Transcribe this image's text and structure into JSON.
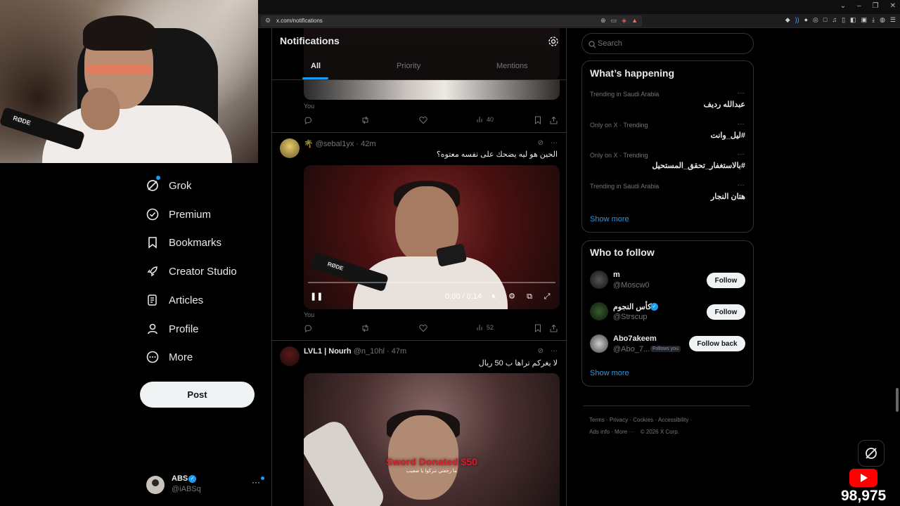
{
  "browser": {
    "url": "x.com/notifications",
    "window_controls": [
      "⌄",
      "–",
      "❐",
      "✕"
    ]
  },
  "nav": {
    "items": [
      {
        "label": "Grok",
        "icon": "grok-icon"
      },
      {
        "label": "Premium",
        "icon": "premium-icon"
      },
      {
        "label": "Bookmarks",
        "icon": "bookmark-icon"
      },
      {
        "label": "Creator Studio",
        "icon": "rocket-icon"
      },
      {
        "label": "Articles",
        "icon": "articles-icon"
      },
      {
        "label": "Profile",
        "icon": "profile-icon"
      },
      {
        "label": "More",
        "icon": "more-icon"
      }
    ],
    "post_label": "Post",
    "account": {
      "name": "ABS",
      "handle": "@iABSq",
      "more": "···"
    }
  },
  "notifications": {
    "title": "Notifications",
    "tabs": [
      "All",
      "Priority",
      "Mentions"
    ],
    "active_tab": "All",
    "first_item": {
      "label": "You",
      "views": "40"
    },
    "tweets": [
      {
        "handle": "@sebal1yx",
        "time": "42m",
        "emoji": "🌴",
        "text": "الحين هو ليه يضحك على نفسه معتوه؟",
        "video_time": "0:00 / 0:14",
        "mic_label": "RØDE",
        "label": "You",
        "views": "52"
      },
      {
        "name": "LVL1 | Nourh",
        "handle": "@n_10hl",
        "time": "47m",
        "text": "لا يغركم تراها ب 50 ريال",
        "overlay_title": "Sword Donated $50",
        "overlay_sub": "ما رجعتي تتركوا يا صعيب"
      }
    ]
  },
  "right": {
    "search_placeholder": "Search",
    "happening": {
      "title": "What’s happening",
      "trends": [
        {
          "meta": "Trending in Saudi Arabia",
          "name": "عبدالله رديف"
        },
        {
          "meta": "Only on X · Trending",
          "name": "#ليل_وانت"
        },
        {
          "meta": "Only on X · Trending",
          "name": "#بالاستغفار_تحقق_المستحيل"
        },
        {
          "meta": "Trending in Saudi Arabia",
          "name": "هتان النجار"
        }
      ],
      "show_more": "Show more"
    },
    "who_to_follow": {
      "title": "Who to follow",
      "people": [
        {
          "name": "m",
          "handle": "@Moscw0",
          "button": "Follow",
          "follows_you": ""
        },
        {
          "name": "كأس النجوم",
          "handle": "@Strscup",
          "button": "Follow",
          "follows_you": ""
        },
        {
          "name": "Abo7akeem",
          "handle": "@Abo_7...",
          "button": "Follow back",
          "follows_you": "Follows you"
        }
      ],
      "show_more": "Show more"
    },
    "footer": {
      "line1": [
        "Terms",
        "Privacy",
        "Cookies",
        "Accessibility"
      ],
      "line2": [
        "Ads info",
        "More ···",
        "© 2026 X Corp."
      ]
    }
  },
  "stream": {
    "viewer_count": "98,975",
    "webcam_mic_label": "RØDE"
  },
  "colors": {
    "accent": "#1d9bf0",
    "background": "#000000",
    "border": "#2f3336",
    "text_primary": "#e7e9ea",
    "text_secondary": "#71767b",
    "donation_red": "#e0182a"
  }
}
